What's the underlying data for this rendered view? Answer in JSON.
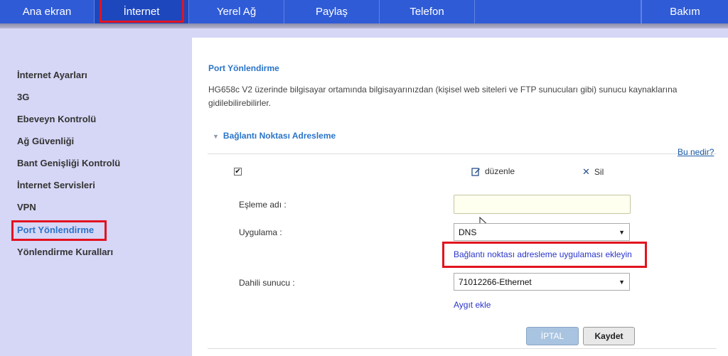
{
  "nav": {
    "tabs": [
      {
        "label": "Ana ekran"
      },
      {
        "label": "İnternet"
      },
      {
        "label": "Yerel Ağ"
      },
      {
        "label": "Paylaş"
      },
      {
        "label": "Telefon"
      },
      {
        "label": "Bakım"
      }
    ],
    "active_index": 1
  },
  "sidebar": {
    "items": [
      {
        "label": "İnternet Ayarları"
      },
      {
        "label": "3G"
      },
      {
        "label": "Ebeveyn Kontrolü"
      },
      {
        "label": "Ağ Güvenliği"
      },
      {
        "label": "Bant Genişliği Kontrolü"
      },
      {
        "label": "İnternet Servisleri"
      },
      {
        "label": "VPN"
      },
      {
        "label": "Port Yönlendirme"
      },
      {
        "label": "Yönlendirme Kuralları"
      }
    ],
    "active_index": 7
  },
  "main": {
    "title": "Port Yönlendirme",
    "description": "HG658c V2 üzerinde bilgisayar ortamında bilgisayarınızdan (kişisel web siteleri ve FTP sunucuları gibi) sunucu kaynaklarına gidilebilirebilirler.",
    "section_title": "Bağlantı Noktası Adresleme",
    "help_link": "Bu nedir?",
    "edit_label": "düzenle",
    "delete_label": "Sil",
    "form": {
      "mapping_name_label": "Eşleme adı :",
      "mapping_name_value": "",
      "application_label": "Uygulama :",
      "application_value": "DNS",
      "add_application_link": "Bağlantı noktası adresleme uygulaması ekleyin",
      "internal_server_label": "Dahili sunucu :",
      "internal_server_value": "71012266-Ethernet",
      "add_device_link": "Aygıt ekle"
    },
    "buttons": {
      "cancel": "İPTAL",
      "save": "Kaydet"
    }
  },
  "icons": {
    "checkbox": "checkbox-checked",
    "edit": "edit-icon",
    "delete": "close-icon",
    "section_toggle": "triangle-down-icon",
    "select_arrow": "triangle-down-icon"
  },
  "colors": {
    "nav_bg": "#2f5bd6",
    "nav_active": "#1d47bd",
    "accent": "#2a74c9",
    "highlight": "#e2131f",
    "sidebar_bg": "#d6d6f6"
  }
}
